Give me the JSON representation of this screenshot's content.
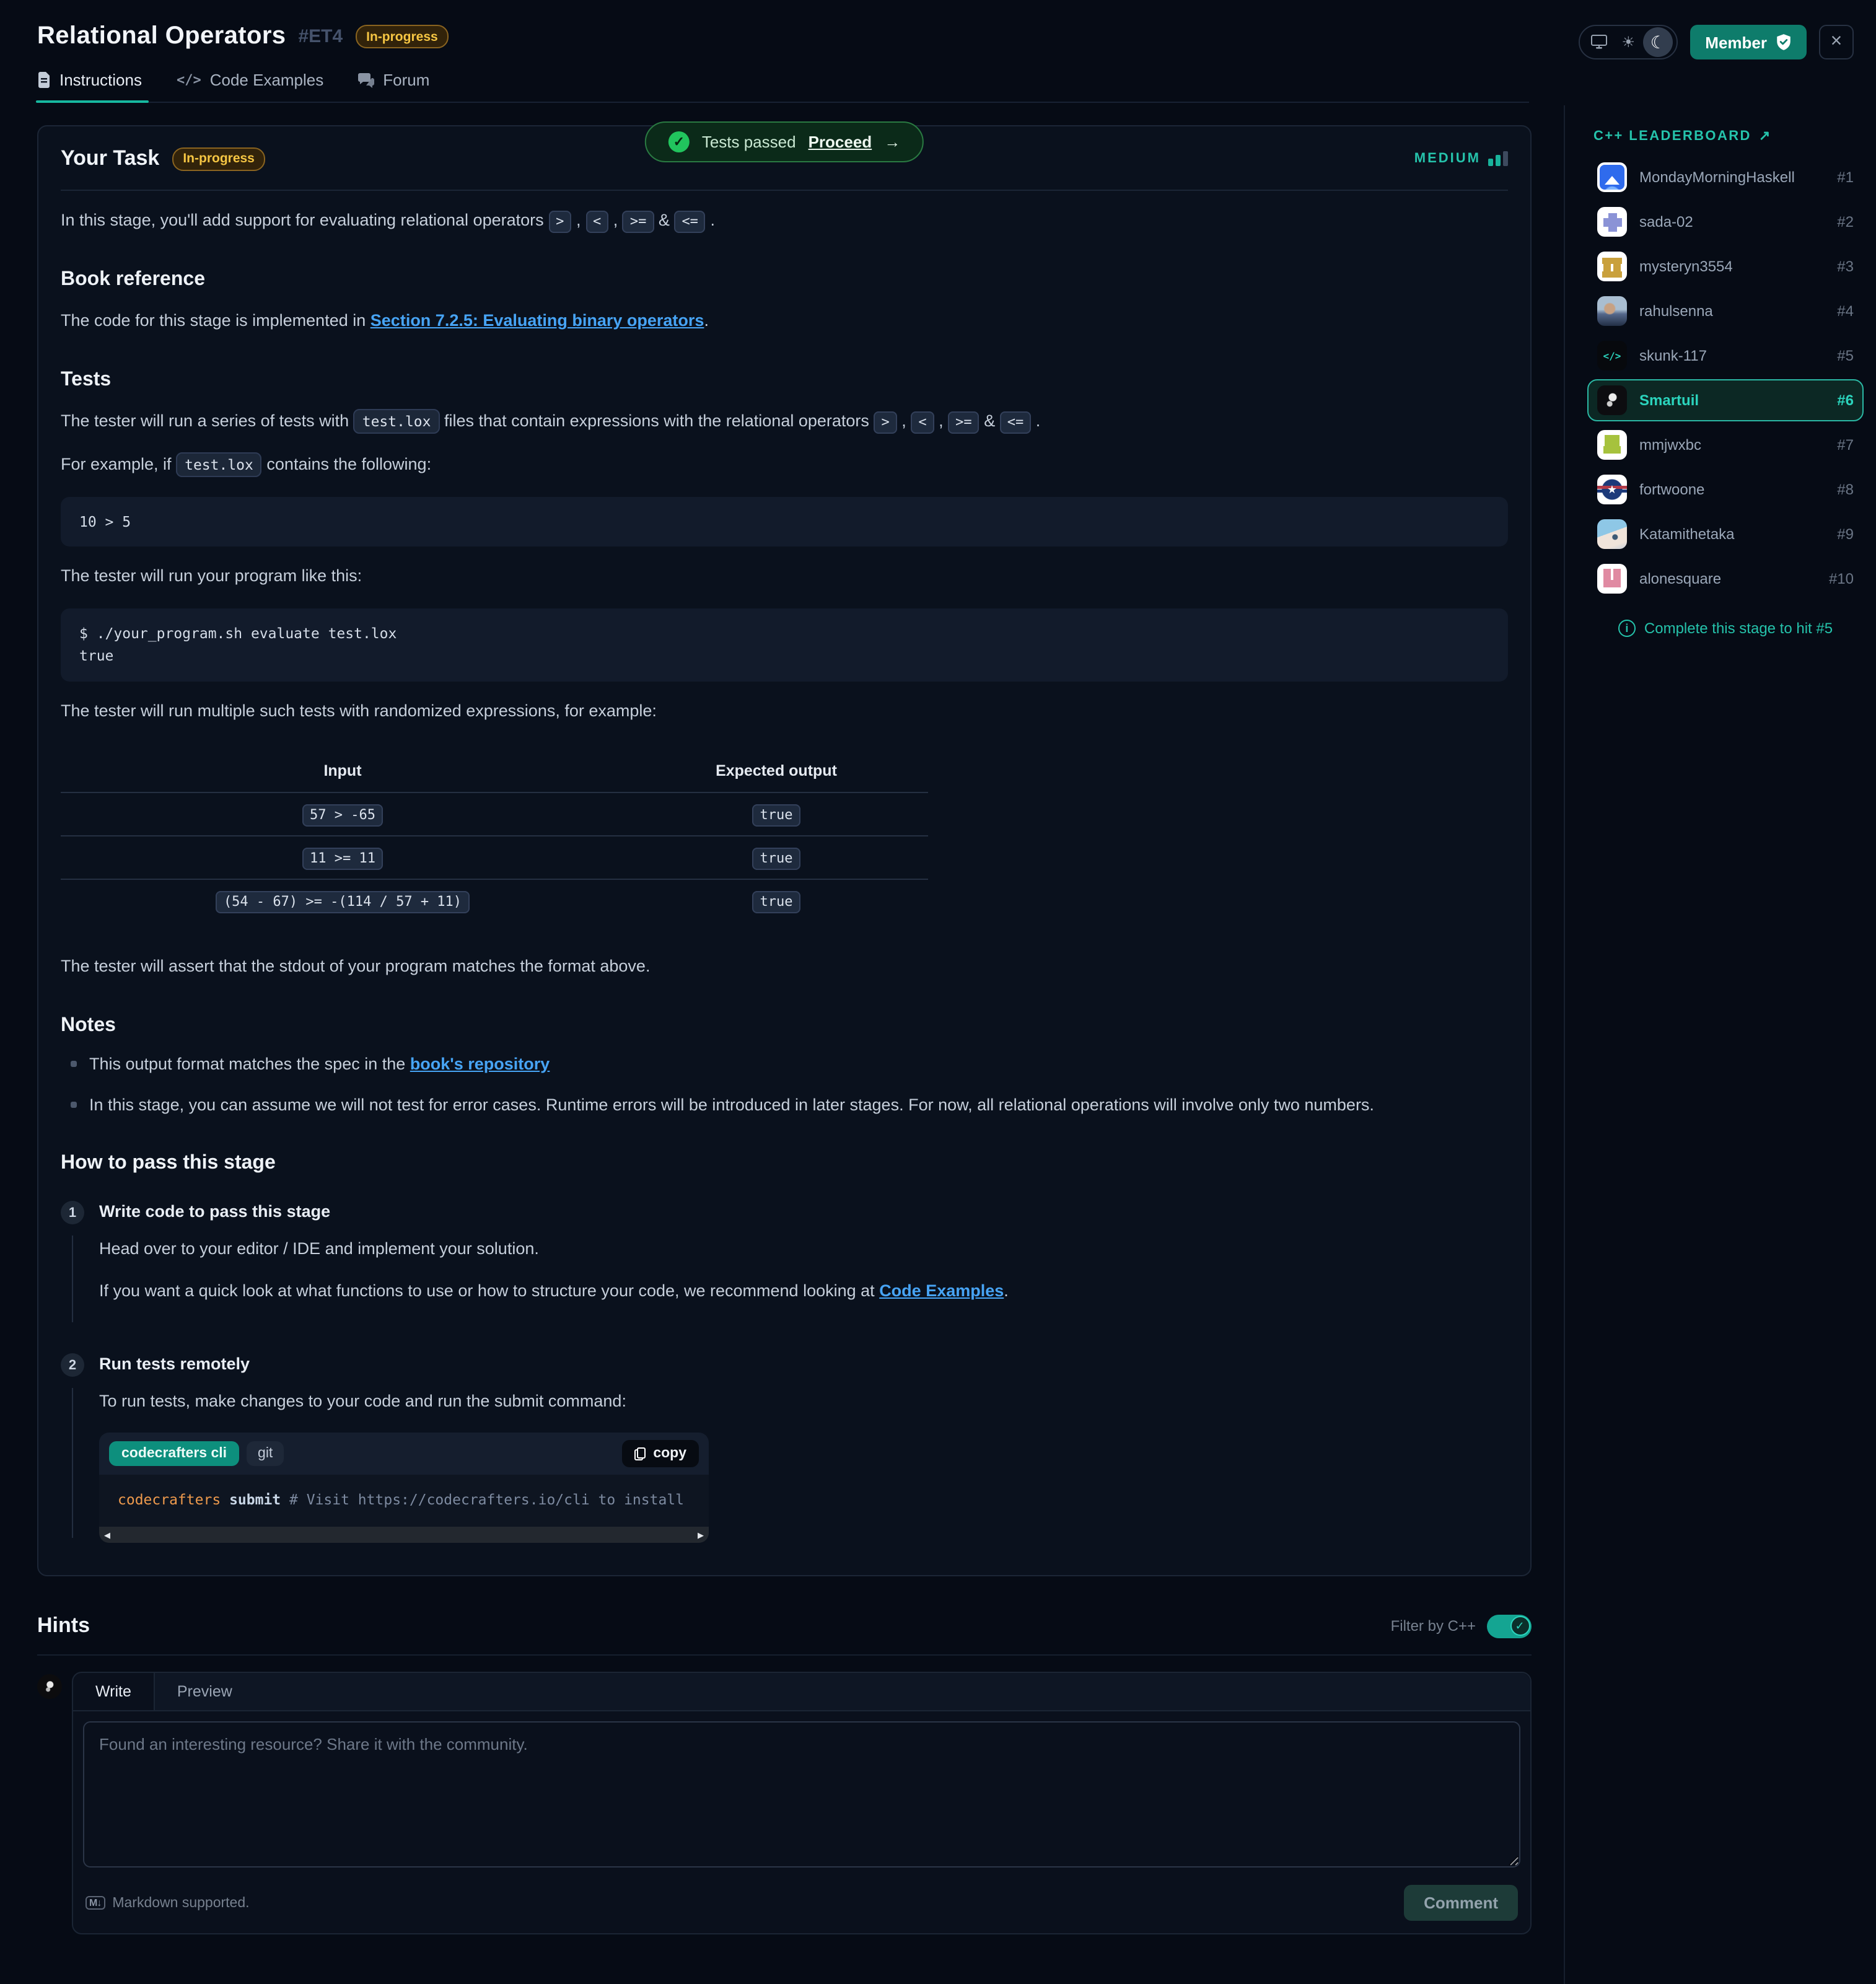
{
  "header": {
    "title": "Relational Operators",
    "stage_id": "#ET4",
    "status_badge": "In-progress",
    "member_label": "Member",
    "tabs": [
      {
        "label": "Instructions"
      },
      {
        "label": "Code Examples"
      },
      {
        "label": "Forum"
      }
    ]
  },
  "icons": {
    "check": "✓",
    "arrow_right": "→",
    "external": "↗",
    "scroll_left": "◀",
    "scroll_right": "▶",
    "markdown": "M↓",
    "sun": "☀",
    "moon": "☾",
    "close": "×",
    "code": "</>",
    "star": "★",
    "info": "i"
  },
  "colors": {
    "accent_teal": "#19b39b",
    "link_blue": "#47a4f5",
    "amber": "#f6c643",
    "success_green": "#21c45d"
  },
  "toast": {
    "text": "Tests passed",
    "action": "Proceed"
  },
  "task": {
    "heading": "Your Task",
    "status_badge": "In-progress",
    "difficulty": "MEDIUM",
    "intro_prefix": "In this stage, you'll add support for evaluating relational operators",
    "operators": [
      ">",
      "<",
      ">=",
      "<="
    ],
    "punct": {
      "comma": ",",
      "amp": "&",
      "period": "."
    }
  },
  "book_reference": {
    "heading": "Book reference",
    "text_prefix": "The code for this stage is implemented in",
    "link": "Section 7.2.5: Evaluating binary operators"
  },
  "tests": {
    "heading": "Tests",
    "p1_prefix": "The tester will run a series of tests with",
    "inline_code": "test.lox",
    "p1_mid": "files that contain expressions with the relational operators",
    "p2_prefix": "For example, if",
    "p2_suffix": "contains the following:",
    "code1": "10 > 5",
    "run_text": "The tester will run your program like this:",
    "code2_line1": "$ ./your_program.sh evaluate test.lox",
    "code2_line2": "true",
    "multi_text": "The tester will run multiple such tests with randomized expressions, for example:",
    "table": {
      "headers": [
        "Input",
        "Expected output"
      ],
      "rows": [
        {
          "input": "57 > -65",
          "output": "true"
        },
        {
          "input": "11 >= 11",
          "output": "true"
        },
        {
          "input": "(54 - 67) >= -(114 / 57 + 11)",
          "output": "true"
        }
      ]
    },
    "assert_text": "The tester will assert that the stdout of your program matches the format above."
  },
  "notes": {
    "heading": "Notes",
    "item1_prefix": "This output format matches the spec in the",
    "item1_link": "book's repository",
    "item2": "In this stage, you can assume we will not test for error cases. Runtime errors will be introduced in later stages. For now, all relational operations will involve only two numbers."
  },
  "how_to_pass": {
    "heading": "How to pass this stage",
    "steps": [
      {
        "number": "1",
        "title": "Write code to pass this stage",
        "p1": "Head over to your editor / IDE and implement your solution.",
        "p2_prefix": "If you want a quick look at what functions to use or how to structure your code, we recommend looking at",
        "p2_link": "Code Examples"
      },
      {
        "number": "2",
        "title": "Run tests remotely",
        "p1": "To run tests, make changes to your code and run the submit command:"
      }
    ],
    "submit_widget": {
      "tab_active": "codecrafters cli",
      "tab_inactive": "git",
      "copy_label": "copy",
      "code_cmd": "codecrafters",
      "code_sub": "submit",
      "code_comment": "# Visit https://codecrafters.io/cli to install"
    }
  },
  "hints": {
    "heading": "Hints",
    "filter_label": "Filter by C++"
  },
  "composer": {
    "tabs": [
      "Write",
      "Preview"
    ],
    "placeholder": "Found an interesting resource? Share it with the community.",
    "markdown_note": "Markdown supported.",
    "submit_label": "Comment"
  },
  "leaderboard": {
    "heading": "C++ LEADERBOARD",
    "items": [
      {
        "name": "MondayMorningHaskell",
        "rank": "#1"
      },
      {
        "name": "sada-02",
        "rank": "#2"
      },
      {
        "name": "mysteryn3554",
        "rank": "#3"
      },
      {
        "name": "rahulsenna",
        "rank": "#4"
      },
      {
        "name": "skunk-117",
        "rank": "#5"
      },
      {
        "name": "Smartuil",
        "rank": "#6"
      },
      {
        "name": "mmjwxbc",
        "rank": "#7"
      },
      {
        "name": "fortwoone",
        "rank": "#8"
      },
      {
        "name": "Katamithetaka",
        "rank": "#9"
      },
      {
        "name": "alonesquare",
        "rank": "#10"
      }
    ],
    "footer_note": "Complete this stage to hit #5"
  }
}
